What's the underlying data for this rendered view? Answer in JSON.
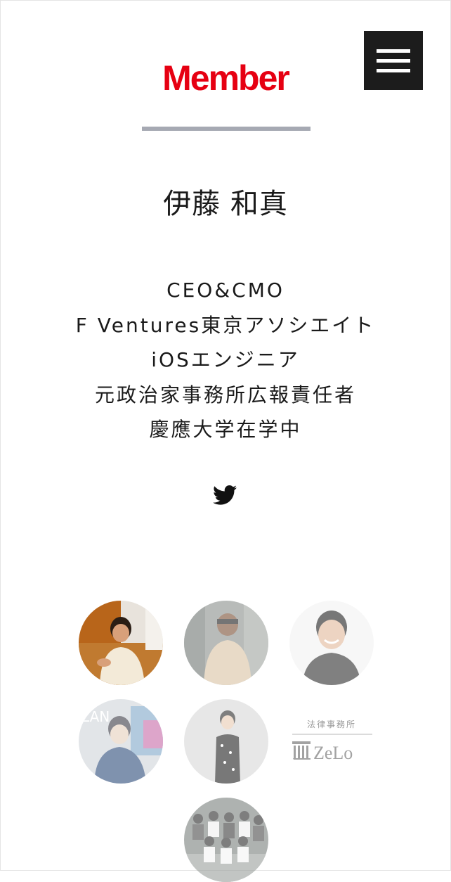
{
  "header": {
    "title": "Member",
    "menu_icon": "hamburger-menu-icon",
    "title_color": "#e60012"
  },
  "profile": {
    "name": "伊藤 和真",
    "bio": [
      "CEO&CMO",
      "F Ventures東京アソシエイト",
      "iOSエンジニア",
      "元政治家事務所広報責任者",
      "慶應大学在学中"
    ],
    "social_icon": "twitter-icon"
  },
  "members_grid": {
    "items": [
      {
        "type": "photo",
        "active": true
      },
      {
        "type": "photo",
        "active": false
      },
      {
        "type": "photo",
        "active": false
      },
      {
        "type": "photo",
        "active": false
      },
      {
        "type": "photo",
        "active": false
      },
      {
        "type": "logo",
        "active": false,
        "logo_top": "法律事務所",
        "logo_main": "ZeLo"
      },
      {
        "type": "photo",
        "active": false
      }
    ]
  }
}
